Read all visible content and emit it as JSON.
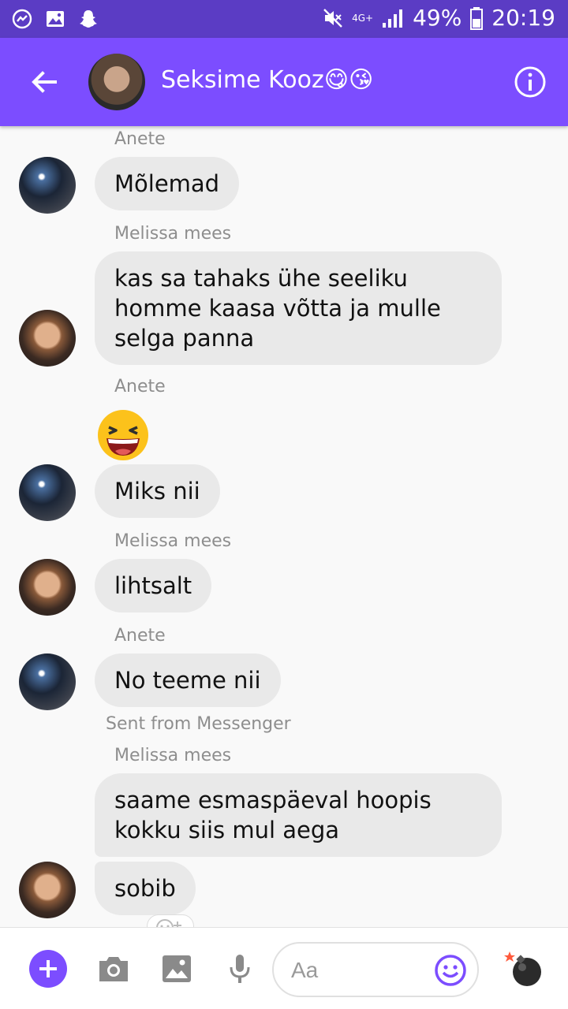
{
  "status_bar": {
    "network": "4G+",
    "battery": "49%",
    "time": "20:19"
  },
  "header": {
    "title": "Seksime Kooz😋😘"
  },
  "messages": [
    {
      "sender": "Anete",
      "text": "Mõlemad"
    },
    {
      "sender": "Melissa mees",
      "text": "kas sa tahaks ühe seeliku\nhomme kaasa võtta ja mulle\nselga panna"
    },
    {
      "sender": "Anete",
      "emoji": "grinning-squinting"
    },
    {
      "text": "Miks nii"
    },
    {
      "sender": "Melissa mees",
      "text": "lihtsalt"
    },
    {
      "sender": "Anete",
      "text": "No teeme nii",
      "note": "Sent from Messenger"
    },
    {
      "sender": "Melissa mees",
      "text": "saame esmaspäeval hoopis\nkokku siis mul aega"
    },
    {
      "text": "sobib"
    }
  ],
  "composer": {
    "placeholder": "Aa"
  },
  "colors": {
    "status_bar": "#5b3cc4",
    "app_bar": "#7c4dff",
    "accent": "#7c4dff",
    "bubble": "#e9e9e9"
  },
  "icons": [
    "messenger-icon",
    "gallery-icon",
    "snapchat-icon",
    "mute-icon",
    "signal-icon",
    "battery-icon",
    "back-arrow-icon",
    "info-icon",
    "plus-icon",
    "camera-icon",
    "image-icon",
    "microphone-icon",
    "emoji-icon",
    "bomb-icon"
  ]
}
